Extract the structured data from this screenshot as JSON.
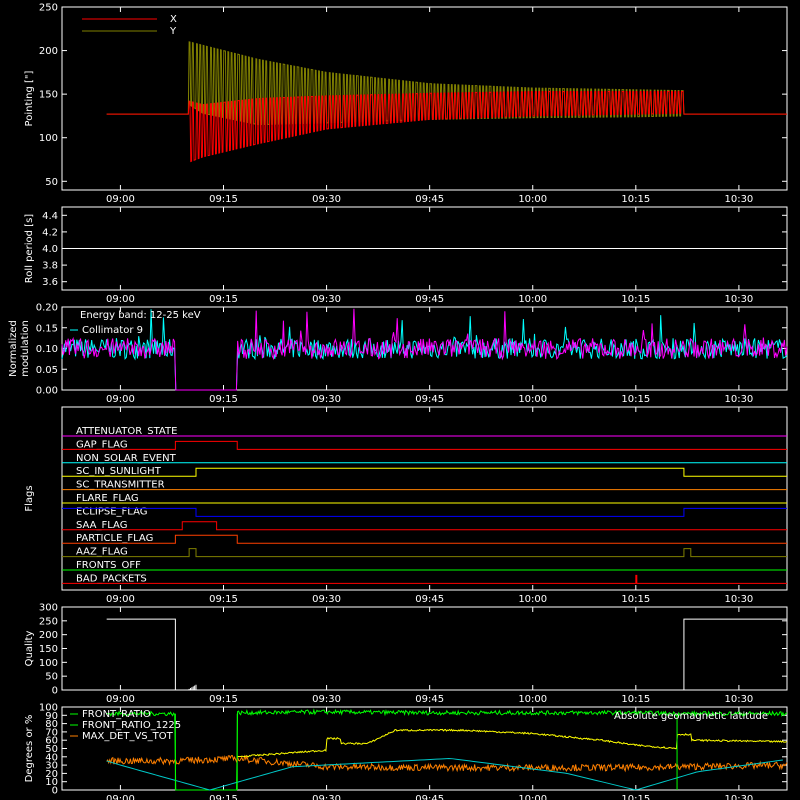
{
  "colors": {
    "background": "#000000",
    "axes": "#ffffff",
    "x_trace": "#ff0000",
    "y_trace": "#808000",
    "collimator": "#00ffff",
    "modulation_magenta": "#ff00ff",
    "front_ratio": "#00ff00",
    "front_ratio_1225": "#00ff00",
    "max_det_vs_tot": "#ff8000",
    "geomag_lat": "#00c8c8",
    "yellow_series": "#ffff00"
  },
  "x_ticks": [
    "09:00",
    "09:15",
    "09:30",
    "09:45",
    "10:00",
    "10:15",
    "10:30"
  ],
  "x_tick_minutes": [
    540,
    555,
    570,
    585,
    600,
    615,
    630
  ],
  "x_range_minutes": [
    531.5,
    637
  ],
  "chart_data": [
    {
      "id": "pointing",
      "type": "line",
      "ylabel": "Pointing [\"]",
      "ylim": [
        40,
        250
      ],
      "yticks": [
        50,
        100,
        150,
        200,
        250
      ],
      "series": [
        {
          "name": "X",
          "color": "#ff0000",
          "x": [
            "08:58",
            "09:10",
            "09:10",
            "09:12",
            "09:20",
            "09:30",
            "09:45",
            "10:00",
            "10:15",
            "10:22",
            "10:22",
            "10:38"
          ],
          "upper": [
            127,
            127,
            142,
            138,
            145,
            148,
            151,
            153,
            153,
            153,
            127,
            127
          ],
          "lower": [
            127,
            127,
            72,
            78,
            93,
            110,
            121,
            125,
            127,
            128,
            127,
            127
          ]
        },
        {
          "name": "Y",
          "color": "#808000",
          "x": [
            "08:58",
            "09:10",
            "09:10",
            "09:12",
            "09:20",
            "09:30",
            "09:45",
            "10:00",
            "10:15",
            "10:22",
            "10:22",
            "10:38"
          ],
          "upper": [
            127,
            127,
            210,
            206,
            190,
            175,
            162,
            157,
            155,
            154,
            127,
            127
          ],
          "lower": [
            127,
            127,
            138,
            128,
            115,
            117,
            121,
            123,
            124,
            125,
            127,
            127
          ]
        }
      ]
    },
    {
      "id": "roll",
      "type": "line",
      "ylabel": "Roll period [s]",
      "ylim": [
        3.5,
        4.5
      ],
      "yticks": [
        "3.6",
        "3.8",
        "4.0",
        "4.2",
        "4.4"
      ],
      "ytick_values": [
        3.6,
        3.8,
        4.0,
        4.2,
        4.4
      ],
      "series": [
        {
          "name": "",
          "x": [
            "08:58",
            "10:38"
          ],
          "y": [
            4.0,
            4.0
          ]
        }
      ]
    },
    {
      "id": "modulation",
      "type": "line",
      "ylabel": "Normalized modulation",
      "ylabel_lines": [
        "Normalized",
        "modulation"
      ],
      "ylim": [
        0,
        0.2
      ],
      "yticks": [
        "0.00",
        "0.05",
        "0.10",
        "0.15",
        "0.20"
      ],
      "ytick_values": [
        0,
        0.05,
        0.1,
        0.15,
        0.2
      ],
      "annotation": "Energy band: 12-25 keV",
      "legend": [
        {
          "name": "Collimator 9",
          "color": "#00ffff"
        }
      ],
      "baseline": 0.1,
      "gaps": [
        [
          "09:08",
          "09:17"
        ]
      ]
    },
    {
      "id": "flags",
      "type": "step",
      "ylabel": "Flags",
      "series": [
        {
          "name": "ATTENUATOR_STATE",
          "color": "#ff00ff",
          "steps": []
        },
        {
          "name": "GAP_FLAG",
          "color": "#ff0000",
          "steps": [
            [
              "09:08",
              "09:17"
            ]
          ]
        },
        {
          "name": "NON_SOLAR_EVENT",
          "color": "#00ffff",
          "steps": []
        },
        {
          "name": "SC_IN_SUNLIGHT",
          "color": "#ffff00",
          "steps": [
            [
              "09:11",
              "10:22"
            ]
          ]
        },
        {
          "name": "SC_TRANSMITTER",
          "color": "#ff8000",
          "steps": []
        },
        {
          "name": "FLARE_FLAG",
          "color": "#ffff00",
          "steps": []
        },
        {
          "name": "ECLIPSE_FLAG",
          "color": "#0000ff",
          "steps": [
            [
              "09:11",
              "10:22"
            ]
          ],
          "inverted": true
        },
        {
          "name": "SAA_FLAG",
          "color": "#ff0000",
          "steps": [
            [
              "09:09",
              "09:14"
            ]
          ]
        },
        {
          "name": "PARTICLE_FLAG",
          "color": "#ff4000",
          "steps": [
            [
              "09:08",
              "09:17"
            ]
          ]
        },
        {
          "name": "AAZ_FLAG",
          "color": "#808000",
          "steps": [
            [
              "09:10",
              "09:11"
            ],
            [
              "10:22",
              "10:23"
            ]
          ]
        },
        {
          "name": "FRONTS_OFF",
          "color": "#00ff00",
          "steps": []
        },
        {
          "name": "BAD_PACKETS",
          "color": "#ff0000",
          "steps": [
            [
              "10:15",
              "10:15"
            ]
          ]
        }
      ]
    },
    {
      "id": "quality",
      "type": "line",
      "ylabel": "Quality",
      "ylim": [
        0,
        300
      ],
      "yticks": [
        "0",
        "50",
        "100",
        "150",
        "200",
        "250",
        "300"
      ],
      "ytick_values": [
        0,
        50,
        100,
        150,
        200,
        250,
        300
      ],
      "series": [
        {
          "name": "",
          "color": "#ffffff",
          "x": [
            "08:58",
            "09:08",
            "09:08",
            "09:19",
            "09:20",
            "10:22",
            "10:22",
            "10:38"
          ],
          "y": [
            256,
            256,
            0,
            0,
            0,
            0,
            256,
            256
          ]
        }
      ]
    },
    {
      "id": "degrees",
      "type": "line",
      "ylabel": "Degrees or %",
      "ylim": [
        0,
        100
      ],
      "yticks": [
        "0",
        "10",
        "20",
        "30",
        "40",
        "50",
        "60",
        "70",
        "80",
        "90",
        "100"
      ],
      "ytick_values": [
        0,
        10,
        20,
        30,
        40,
        50,
        60,
        70,
        80,
        90,
        100
      ],
      "legend": [
        {
          "name": "FRONT_RATIO",
          "color": "#00ff00"
        },
        {
          "name": "FRONT_RATIO_1225",
          "color": "#00ff00"
        },
        {
          "name": "MAX_DET_VS_TOT",
          "color": "#ff8000"
        }
      ],
      "right_label": {
        "name": "Absolute geomagnetic latitude",
        "color": "#00ffff"
      },
      "series": [
        {
          "name": "FRONT_RATIO",
          "color": "#00ff00",
          "x": [
            "08:58",
            "09:08",
            "09:08",
            "09:17",
            "09:17",
            "09:30",
            "09:45",
            "10:00",
            "10:15",
            "10:21",
            "10:21",
            "10:38"
          ],
          "y": [
            92,
            92,
            0,
            0,
            93,
            94,
            93,
            93,
            93,
            92,
            92,
            92
          ]
        },
        {
          "name": "MAX_DET_VS_TOT",
          "color": "#ff8000",
          "x": [
            "08:58",
            "09:08",
            "09:17",
            "09:30",
            "09:45",
            "10:00",
            "10:15",
            "10:21",
            "10:38"
          ],
          "y": [
            35,
            35,
            38,
            28,
            27,
            27,
            27,
            28,
            30
          ]
        },
        {
          "name": "Absolute geomagnetic latitude",
          "color": "#00c8c8",
          "x": [
            "08:58",
            "09:00",
            "09:13",
            "09:25",
            "09:48",
            "10:05",
            "10:15",
            "10:24",
            "10:38"
          ],
          "y": [
            35,
            30,
            0,
            28,
            38,
            20,
            0,
            22,
            38
          ]
        },
        {
          "name": "",
          "color": "#ffff00",
          "x": [
            "09:17",
            "09:30",
            "09:30",
            "09:32",
            "09:32",
            "09:36",
            "09:40",
            "09:50",
            "10:00",
            "10:10",
            "10:15",
            "10:21",
            "10:21",
            "10:23",
            "10:23",
            "10:38"
          ],
          "y": [
            40,
            48,
            62,
            62,
            56,
            56,
            72,
            72,
            68,
            60,
            54,
            50,
            67,
            67,
            60,
            58
          ]
        }
      ]
    }
  ]
}
